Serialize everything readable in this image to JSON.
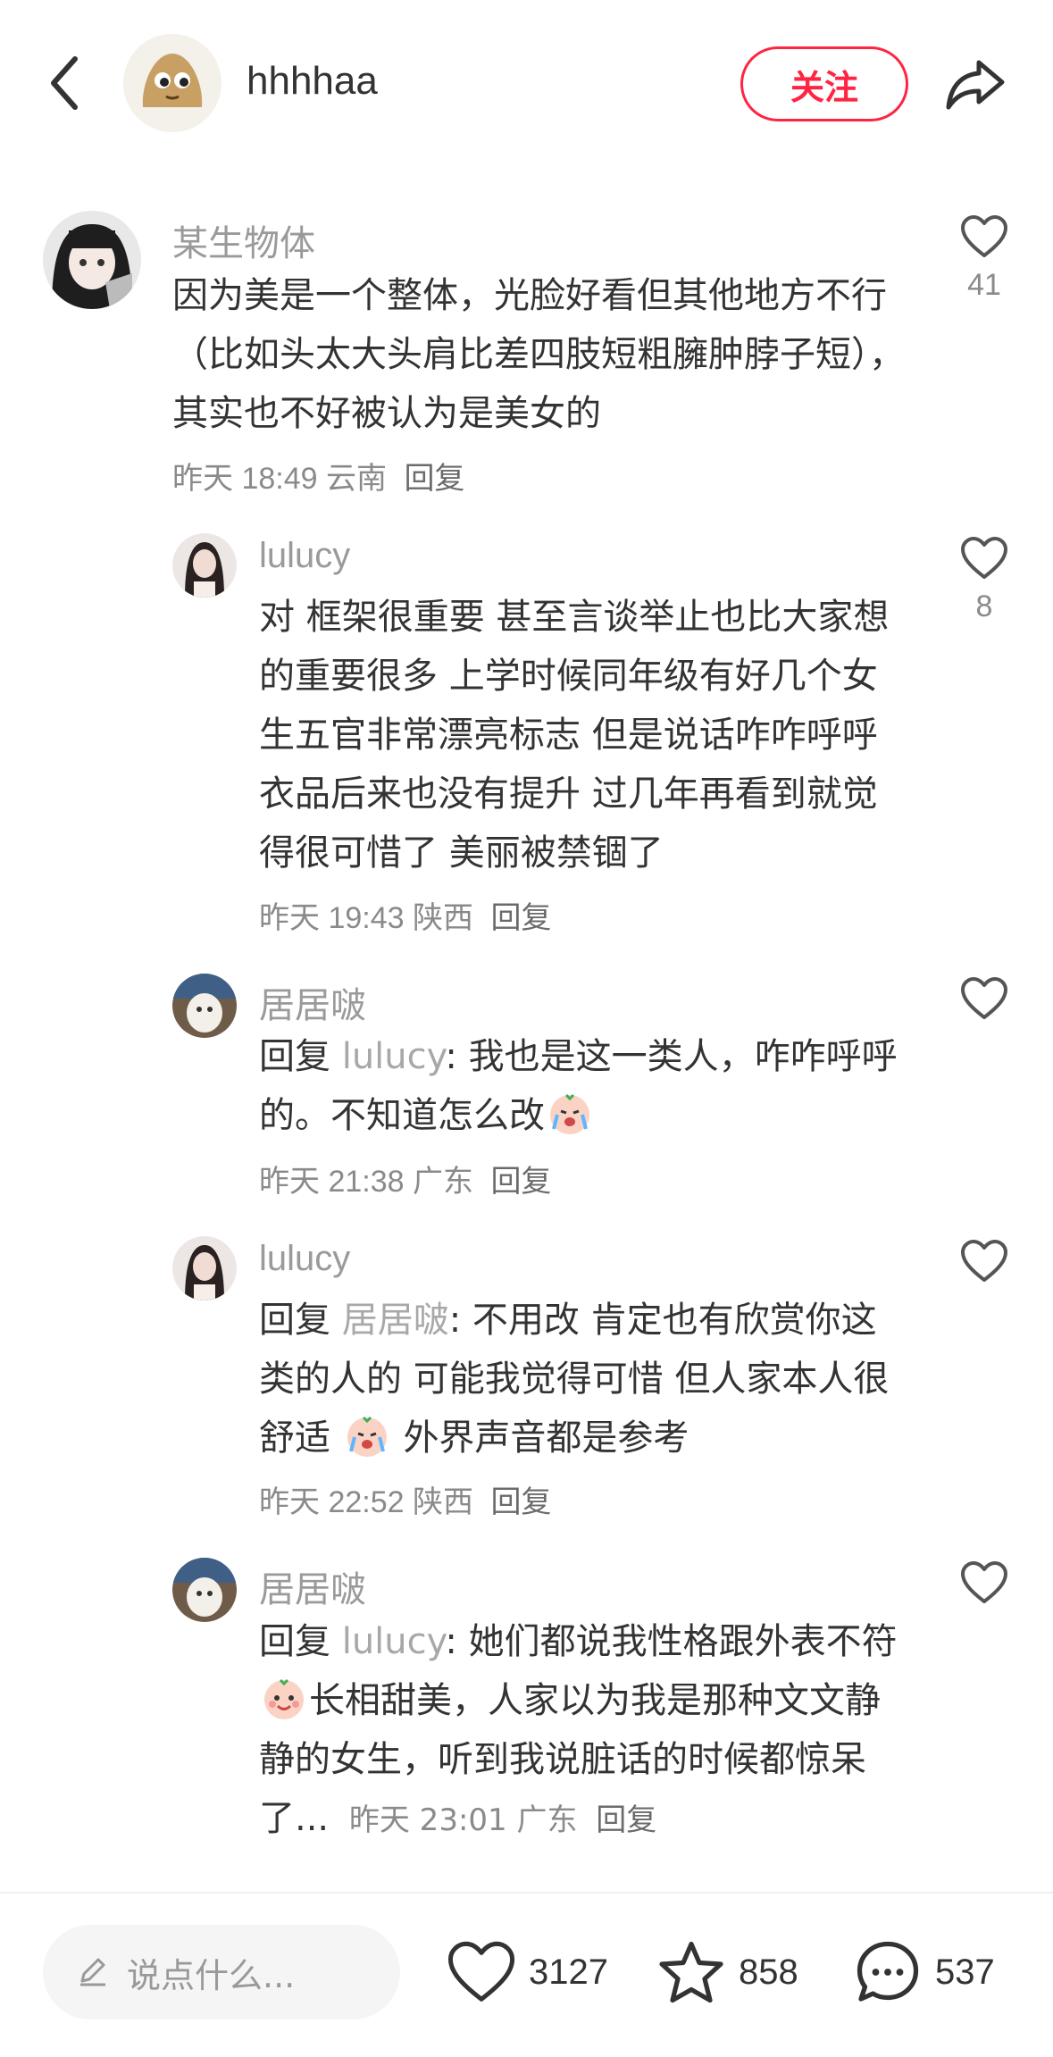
{
  "header": {
    "author_name": "hhhhaa",
    "follow_label": "关注"
  },
  "comments": [
    {
      "user": "某生物体",
      "text": "因为美是一个整体，光脸好看但其他地方不行（比如头太大头肩比差四肢短粗臃肿脖子短），其实也不好被认为是美女的",
      "time": "昨天 18:49",
      "location": "云南",
      "reply_label": "回复",
      "likes": "41"
    },
    {
      "user": "lulucy",
      "text": "对 框架很重要 甚至言谈举止也比大家想的重要很多 上学时候同年级有好几个女生五官非常漂亮标志 但是说话咋咋呼呼 衣品后来也没有提升 过几年再看到就觉得很可惜了 美丽被禁锢了",
      "time": "昨天 19:43",
      "location": "陕西",
      "reply_label": "回复",
      "likes": "8"
    },
    {
      "user": "居居啵",
      "reply_prefix": "回复",
      "mention": "lulucy",
      "text_a": ": 我也是这一类人，咋咋呼呼的。不知道怎么改",
      "time": "昨天 21:38",
      "location": "广东",
      "reply_label": "回复"
    },
    {
      "user": "lulucy",
      "reply_prefix": "回复",
      "mention": "居居啵",
      "text_a": ": 不用改 肯定也有欣赏你这类的人的 可能我觉得可惜 但人家本人很舒适",
      "text_b": "外界声音都是参考",
      "time": "昨天 22:52",
      "location": "陕西",
      "reply_label": "回复"
    },
    {
      "user": "居居啵",
      "reply_prefix": "回复",
      "mention": "lulucy",
      "text_a": ": 她们都说我性格跟外表不符",
      "text_b": "长相甜美，人家以为我是那种文文静静的女生，听到我说脏话的时候都惊呆了...",
      "time": "昨天 23:01",
      "location": "广东",
      "reply_label": "回复"
    }
  ],
  "bottom_bar": {
    "input_placeholder": "说点什么...",
    "like_count": "3127",
    "collect_count": "858",
    "comment_count": "537"
  },
  "icons": [
    "back-icon",
    "share-icon",
    "heart-icon",
    "star-icon",
    "chat-icon",
    "pencil-icon",
    "crying-emoji",
    "happy-emoji"
  ],
  "colors": {
    "accent": "#ff2442",
    "meta": "#8a8a8a",
    "name": "#9a9a9a"
  }
}
